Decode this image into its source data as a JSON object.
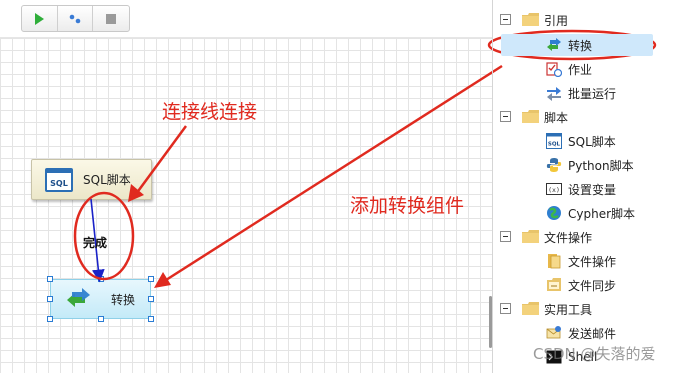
{
  "toolbar": {
    "buttons": [
      {
        "name": "run",
        "icon": "play-icon"
      },
      {
        "name": "debug",
        "icon": "dots-icon"
      },
      {
        "name": "stop",
        "icon": "stop-icon"
      }
    ]
  },
  "canvas": {
    "nodes": {
      "sql": {
        "label": "SQL脚本",
        "icon_text": "SQL"
      },
      "convert": {
        "label": "转换"
      }
    },
    "edge_label": "完成"
  },
  "annotations": {
    "connect": "连接线连接",
    "add": "添加转换组件"
  },
  "tree": {
    "groups": [
      {
        "label": "引用",
        "items": [
          {
            "label": "转换",
            "selected": true,
            "icon": "convert-icon"
          },
          {
            "label": "作业",
            "icon": "job-icon"
          },
          {
            "label": "批量运行",
            "icon": "batch-run-icon"
          }
        ]
      },
      {
        "label": "脚本",
        "items": [
          {
            "label": "SQL脚本",
            "icon": "sql-icon"
          },
          {
            "label": "Python脚本",
            "icon": "python-icon"
          },
          {
            "label": "设置变量",
            "icon": "variable-icon"
          },
          {
            "label": "Cypher脚本",
            "icon": "cypher-icon"
          }
        ]
      },
      {
        "label": "文件操作",
        "items": [
          {
            "label": "文件操作",
            "icon": "file-icon"
          },
          {
            "label": "文件同步",
            "icon": "file-sync-icon"
          }
        ]
      },
      {
        "label": "实用工具",
        "items": [
          {
            "label": "发送邮件",
            "icon": "mail-icon"
          },
          {
            "label": "Shell",
            "icon": "shell-icon"
          }
        ]
      }
    ]
  },
  "watermark": "CSDN @失落的爱",
  "colors": {
    "annotation": "#e02a1f",
    "selected": "#cfe8fb",
    "edge": "#1a22c8"
  }
}
